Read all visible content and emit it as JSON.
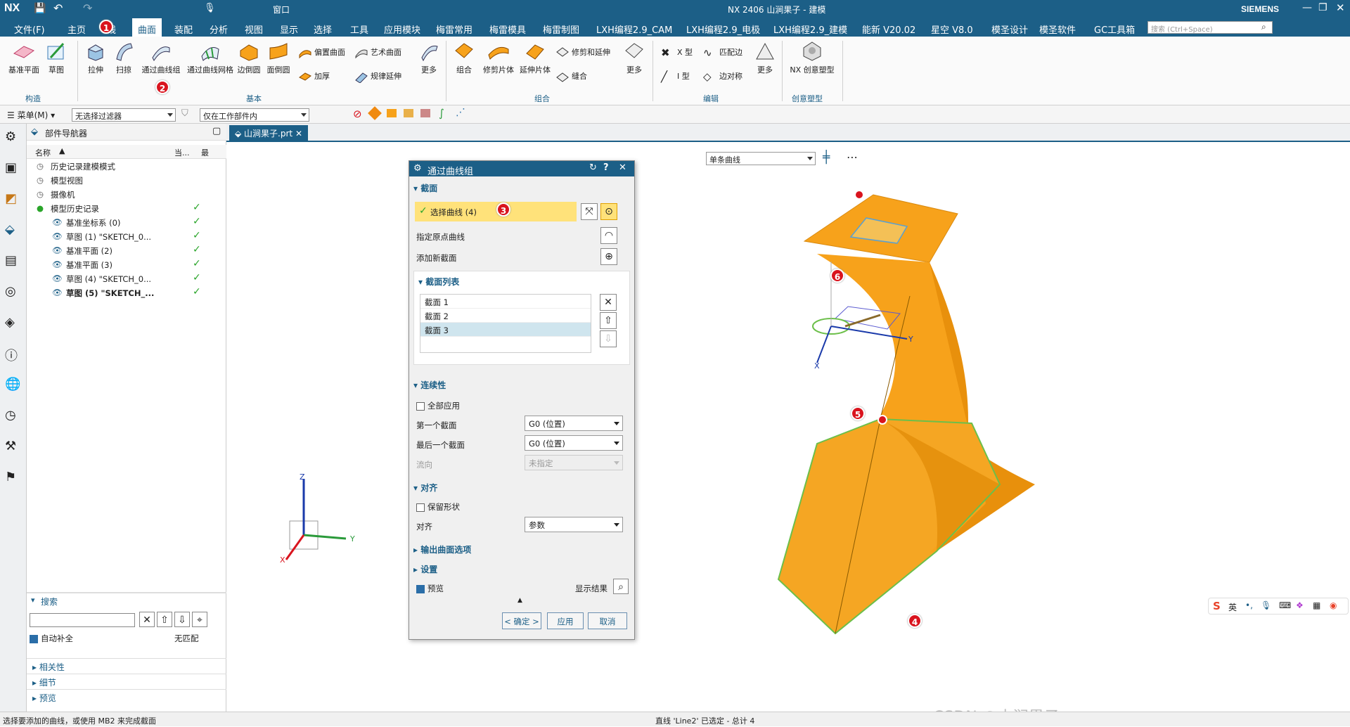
{
  "titlebar": {
    "logo": "NX",
    "title": "NX 2406 山涧果子 - 建模",
    "brand": "SIEMENS",
    "window_menu": "窗口"
  },
  "menubar": {
    "items": [
      "文件(F)",
      "主页",
      "线",
      "曲面",
      "装配",
      "分析",
      "视图",
      "显示",
      "选择",
      "工具",
      "应用模块",
      "梅雷常用",
      "梅雷模具",
      "梅雷制图",
      "LXH编程2.9_CAM",
      "LXH编程2.9_电极",
      "LXH编程2.9_建模",
      "能新 V20.02",
      "星空 V8.0",
      "模圣设计",
      "模圣软件",
      "GC工具箱"
    ],
    "active": "曲面",
    "search_placeholder": "搜索 (Ctrl+Space)"
  },
  "ribbon": {
    "construct": {
      "items": [
        "基准平面",
        "草图"
      ],
      "group": "构造"
    },
    "base": {
      "items": [
        "拉伸",
        "扫掠",
        "通过曲线组",
        "通过曲线网格",
        "边倒圆",
        "面倒圆"
      ],
      "small": [
        "偏置曲面",
        "加厚",
        "艺术曲面",
        "规律延伸"
      ],
      "more": "更多",
      "group": "基本"
    },
    "combine": {
      "items": [
        "组合",
        "修剪片体",
        "延伸片体"
      ],
      "small": [
        "修剪和延伸",
        "缝合"
      ],
      "more": "更多",
      "group": "组合"
    },
    "edit": {
      "small": [
        "X 型",
        "匹配边",
        "I 型",
        "边对称"
      ],
      "more": "更多",
      "group": "编辑"
    },
    "creative": {
      "items": [
        "NX 创意塑型"
      ],
      "group": "创意塑型"
    }
  },
  "toolbar2": {
    "menu": "菜单(M)",
    "filter": "无选择过滤器",
    "scope": "仅在工作部件内"
  },
  "navigator": {
    "title": "部件导航器",
    "columns": [
      "名称",
      "当...",
      "最"
    ],
    "rows": [
      {
        "label": "历史记录建模模式",
        "check": false,
        "bold": false
      },
      {
        "label": "模型视图",
        "check": false,
        "bold": false
      },
      {
        "label": "摄像机",
        "check": false,
        "bold": false
      },
      {
        "label": "模型历史记录",
        "check": true,
        "bold": false
      },
      {
        "label": "基准坐标系 (0)",
        "check": true,
        "bold": false
      },
      {
        "label": "草图 (1) \"SKETCH_0...",
        "check": true,
        "bold": false
      },
      {
        "label": "基准平面 (2)",
        "check": true,
        "bold": false
      },
      {
        "label": "基准平面 (3)",
        "check": true,
        "bold": false
      },
      {
        "label": "草图 (4) \"SKETCH_0...",
        "check": true,
        "bold": false
      },
      {
        "label": "草图 (5) \"SKETCH_...",
        "check": true,
        "bold": true
      }
    ],
    "search": {
      "title": "搜索",
      "autocomplete": "自动补全",
      "nomatch": "无匹配"
    },
    "panels": [
      "相关性",
      "细节",
      "预览"
    ]
  },
  "tab": {
    "label": "山涧果子.prt"
  },
  "viewtoolbar": {
    "curve_rule": "单条曲线"
  },
  "dialog": {
    "title": "通过曲线组",
    "section": {
      "header": "截面",
      "select_curve": "选择曲线 (4)",
      "origin_curve": "指定原点曲线",
      "add_new": "添加新截面",
      "list_header": "截面列表",
      "list": [
        "截面 1",
        "截面 2",
        "截面 3"
      ],
      "selected_index": 2
    },
    "continuity": {
      "header": "连续性",
      "apply_all": "全部应用",
      "first_label": "第一个截面",
      "first_value": "G0 (位置)",
      "last_label": "最后一个截面",
      "last_value": "G0 (位置)",
      "flow_label": "流向",
      "flow_value": "未指定"
    },
    "alignment": {
      "header": "对齐",
      "keep_shape": "保留形状",
      "align_label": "对齐",
      "align_value": "参数"
    },
    "output": "输出曲面选项",
    "settings": "设置",
    "preview": "预览",
    "show_result": "显示结果",
    "ok": "< 确定 >",
    "apply": "应用",
    "cancel": "取消"
  },
  "badges": [
    "1",
    "2",
    "3",
    "4",
    "5",
    "6"
  ],
  "triad": {
    "x": "X",
    "y": "Y",
    "z": "Z"
  },
  "status": {
    "left": "选择要添加的曲线，或使用 MB2 来完成截面",
    "center": "直线 'Line2' 已选定 - 总计 4"
  },
  "watermark": "CSDN @山涧果子",
  "ime": {
    "lang": "英"
  },
  "colors": {
    "brand": "#1c5f87",
    "surface": "#f7a21b",
    "highlight": "#ffe27a",
    "badge": "#d9141e"
  }
}
